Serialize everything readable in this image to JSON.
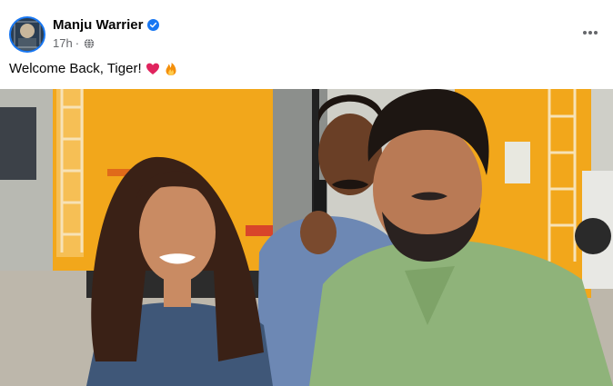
{
  "post": {
    "author": "Manju Warrier",
    "verified_icon": "verified-badge-icon",
    "timestamp": "17h",
    "separator": "·",
    "audience_icon": "globe-icon",
    "more_icon": "more-options-icon",
    "caption": "Welcome Back, Tiger!",
    "caption_emojis": [
      "heart-emoji",
      "fire-emoji"
    ],
    "photo_icon": "post-photo"
  },
  "colors": {
    "text_primary": "#050505",
    "text_secondary": "#65676b",
    "verified_blue": "#1877f2",
    "heart_red": "#e0245e"
  }
}
